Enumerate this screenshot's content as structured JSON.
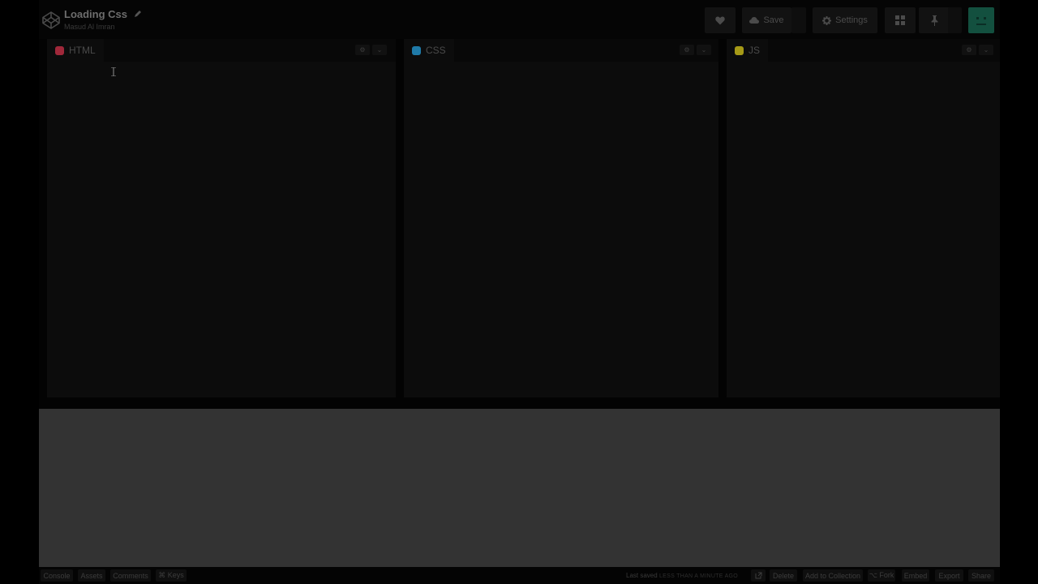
{
  "header": {
    "title": "Loading Css",
    "author": "Masud Al Imran",
    "save_label": "Save",
    "settings_label": "Settings",
    "icons": {
      "logo": "codepen-logo-icon",
      "pencil": "pencil-icon",
      "heart": "heart-icon",
      "cloud": "cloud-icon",
      "gear": "gear-icon",
      "layout": "layout-grid-icon",
      "pin": "pin-icon"
    }
  },
  "editors": [
    {
      "label": "HTML",
      "color": "#a0283a"
    },
    {
      "label": "CSS",
      "color": "#1f7aa8"
    },
    {
      "label": "JS",
      "color": "#a69a17"
    }
  ],
  "editor_controls": {
    "settings_glyph": "⚙",
    "collapse_glyph": "⌄"
  },
  "footer": {
    "console": "Console",
    "assets": "Assets",
    "comments": "Comments",
    "keys": "⌘ Keys",
    "last_saved": "Last saved",
    "last_saved_when": "LESS THAN A MINUTE AGO",
    "delete": "Delete",
    "add_to_collection": "Add to Collection",
    "fork": "⌥ Fork",
    "embed": "Embed",
    "export": "Export",
    "share": "Share"
  },
  "colors": {
    "avatar": "#13503f",
    "preview_bg": "#333333"
  }
}
